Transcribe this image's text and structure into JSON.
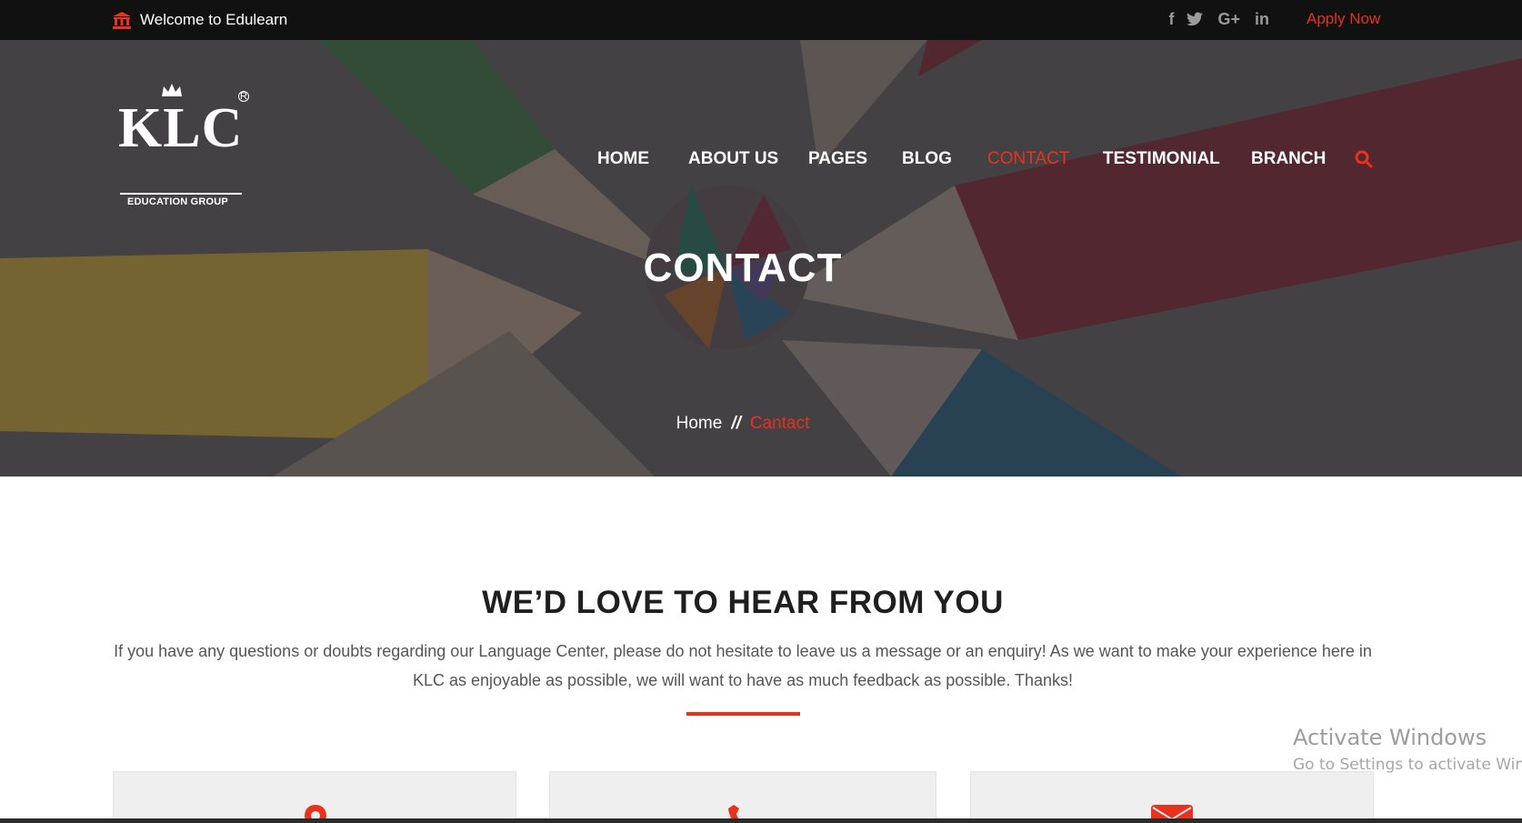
{
  "topbar": {
    "welcome": "Welcome to Edulearn",
    "welcome_icon": "bank-icon",
    "social": [
      {
        "name": "facebook-icon",
        "glyph": "f"
      },
      {
        "name": "twitter-icon",
        "glyph": "🐦"
      },
      {
        "name": "google-plus-icon",
        "glyph": "G+"
      },
      {
        "name": "linkedin-icon",
        "glyph": "in"
      }
    ],
    "apply": "Apply Now"
  },
  "logo": {
    "brand": "KLC",
    "subtitle": "EDUCATION GROUP",
    "registered": "R"
  },
  "nav": {
    "items": [
      {
        "label": "HOME"
      },
      {
        "label": "ABOUT US"
      },
      {
        "label": "PAGES"
      },
      {
        "label": "BLOG"
      },
      {
        "label": "CONTACT",
        "active": true
      },
      {
        "label": "TESTIMONIAL"
      },
      {
        "label": "BRANCH"
      }
    ],
    "search_icon": "search-icon"
  },
  "hero": {
    "title": "CONTACT",
    "breadcrumb": {
      "home": "Home",
      "separator": "//",
      "current": "Cantact"
    }
  },
  "content": {
    "title": "WE’D LOVE TO HEAR FROM YOU",
    "intro": "If you have any questions or doubts regarding our Language Center, please do not hesitate to leave us a message or an enquiry! As we want to make your experience here in KLC as enjoyable as possible, we will want to have as much feedback as possible. Thanks!",
    "cards": [
      {
        "icon": "location-pin-icon"
      },
      {
        "icon": "phone-icon"
      },
      {
        "icon": "envelope-icon"
      }
    ]
  },
  "watermark": {
    "title": "Activate Windows",
    "subtitle": "Go to Settings to activate Windows."
  },
  "colors": {
    "accent": "#e8321e",
    "topbar": "#111111",
    "text_dark": "#1f1f1f"
  }
}
